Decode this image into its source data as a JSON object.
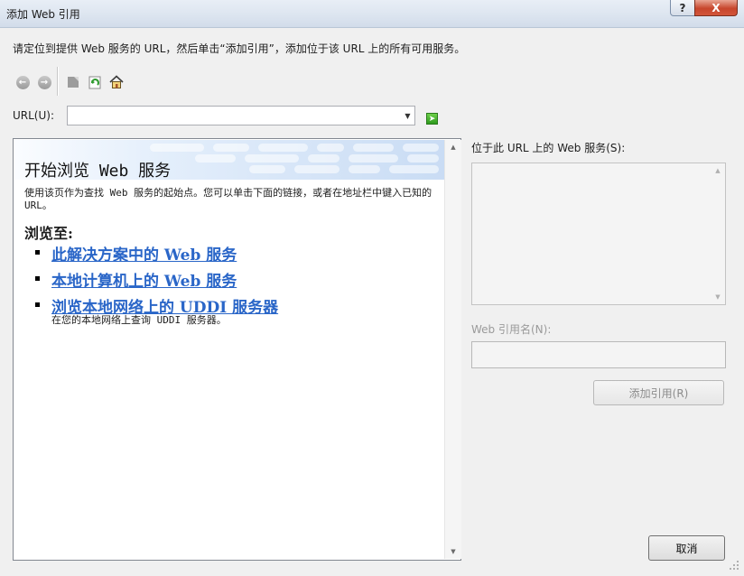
{
  "window": {
    "title": "添加 Web 引用",
    "help_label": "?",
    "close_label": "X"
  },
  "instruction": "请定位到提供 Web 服务的 URL，然后单击“添加引用”，添加位于该 URL 上的所有可用服务。",
  "toolbar": {
    "icons": [
      "back-icon",
      "forward-icon",
      "stop-icon",
      "refresh-icon",
      "home-icon"
    ]
  },
  "url": {
    "label": "URL(U):",
    "value": ""
  },
  "browser": {
    "banner_title": "开始浏览 Web 服务",
    "intro": "使用该页作为查找 Web 服务的起始点。您可以单击下面的链接，或者在地址栏中键入已知的 URL。",
    "browse_to": "浏览至:",
    "links": [
      {
        "label": "此解决方案中的 Web 服务"
      },
      {
        "label": "本地计算机上的 Web 服务"
      },
      {
        "label": "浏览本地网络上的 UDDI 服务器",
        "desc": "在您的本地网络上查询 UDDI 服务器。"
      }
    ]
  },
  "right_panel": {
    "services_label": "位于此 URL 上的 Web 服务(S):",
    "ref_name_label": "Web 引用名(N):",
    "ref_name_value": "",
    "add_ref_label": "添加引用(R)",
    "cancel_label": "取消"
  },
  "colors": {
    "link": "#2a66c8",
    "title_bar": "#dfe7f1",
    "close_button": "#c7462c"
  }
}
